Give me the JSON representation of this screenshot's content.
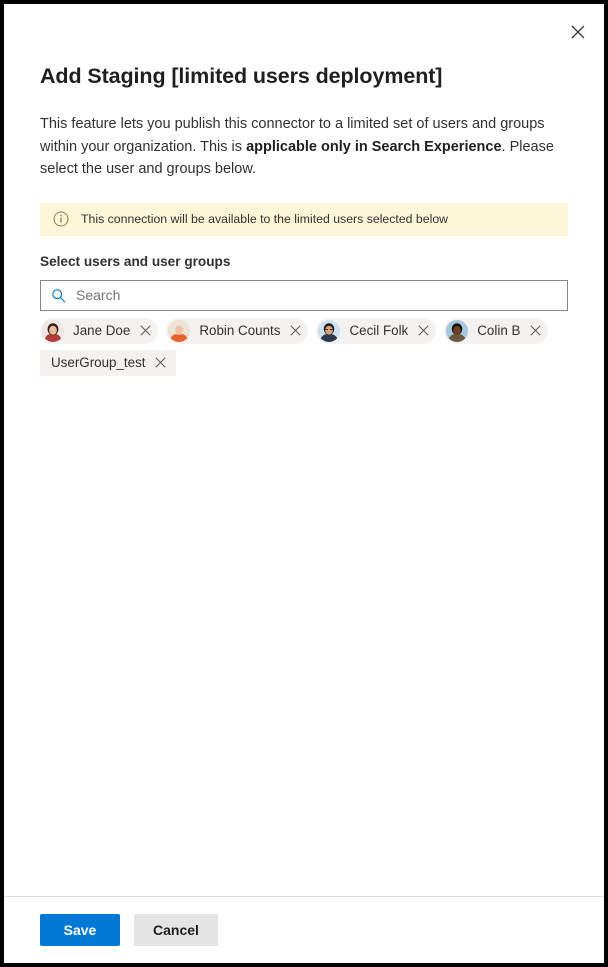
{
  "dialog": {
    "title": "Add Staging [limited users deployment]",
    "close_icon": "close-icon",
    "description": {
      "part1": "This feature lets you publish this connector to a limited set of users and groups within your organization. This is ",
      "bold": "applicable only in Search Experience",
      "part2": ". Please select the user and groups below."
    }
  },
  "info_banner": {
    "icon": "info-circle-icon",
    "text": "This connection will be available to the limited users selected below",
    "background_color": "#fdf6d9"
  },
  "field": {
    "label": "Select users and user groups",
    "search": {
      "icon": "search-icon",
      "value": "",
      "placeholder": "Search",
      "icon_color": "#0078d4"
    }
  },
  "chips": [
    {
      "name": "Jane Doe",
      "type": "person",
      "avatar": "avatar-jane-doe",
      "remove_icon": "close-icon",
      "avatar_colors": {
        "bg": "#efe7e2",
        "hair": "#2b1d17",
        "skin": "#e8b99a",
        "top": "#b33a3a"
      }
    },
    {
      "name": "Robin Counts",
      "type": "person",
      "avatar": "avatar-robin-counts",
      "remove_icon": "close-icon",
      "avatar_colors": {
        "bg": "#f0e2d4",
        "hair": "#e8e2da",
        "skin": "#f0c3a5",
        "top": "#e8622c"
      }
    },
    {
      "name": "Cecil Folk",
      "type": "person",
      "avatar": "avatar-cecil-folk",
      "remove_icon": "close-icon",
      "avatar_colors": {
        "bg": "#cfe0ee",
        "hair": "#1d1813",
        "skin": "#d8a178",
        "top": "#2b3a52"
      }
    },
    {
      "name": "Colin B",
      "type": "person",
      "avatar": "avatar-colin-b",
      "remove_icon": "close-icon",
      "avatar_colors": {
        "bg": "#a8c8de",
        "hair": "#140f0c",
        "skin": "#6d4227",
        "top": "#6c5a3e"
      }
    },
    {
      "name": "UserGroup_test",
      "type": "group",
      "avatar": null,
      "remove_icon": "close-icon"
    }
  ],
  "footer": {
    "save_label": "Save",
    "cancel_label": "Cancel",
    "primary_color": "#0078d4",
    "secondary_color": "#e5e5e5"
  }
}
